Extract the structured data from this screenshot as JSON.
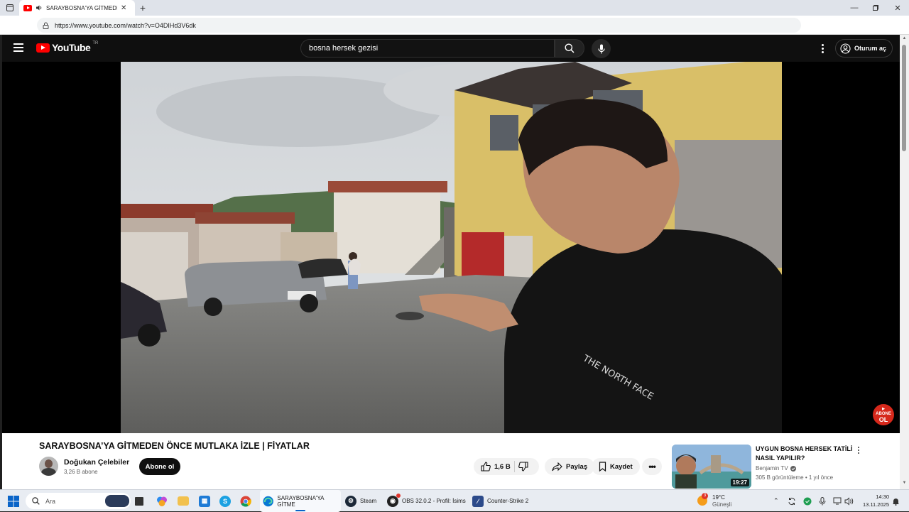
{
  "browser": {
    "tab_title": "SARAYBOSNA'YA GİTMEDEN",
    "url": "https://www.youtube.com/watch?v=O4DIHd3V6dk"
  },
  "youtube": {
    "logo_text": "YouTube",
    "region": "TR",
    "search_query": "bosna hersek gezisi",
    "signin_label": "Oturum aç",
    "badge_line1": "ABONE",
    "badge_line2": "OL"
  },
  "video": {
    "title": "SARAYBOSNA’YA GİTMEDEN ÖNCE MUTLAKA İZLE | FİYATLAR",
    "channel_name": "Doğukan Çelebiler",
    "subscribers": "3,26 B abone",
    "subscribe_label": "Abone ol",
    "likes": "1,6 B",
    "share_label": "Paylaş",
    "save_label": "Kaydet"
  },
  "recommendation": {
    "title": "UYGUN BOSNA HERSEK TATİLİ NASIL YAPILIR?",
    "channel": "Benjamin TV",
    "meta": "305 B görüntüleme • 1 yıl önce",
    "duration": "19:27"
  },
  "taskbar": {
    "search_placeholder": "Ara",
    "items": [
      {
        "label": "SARAYBOSNA'YA GİTME"
      },
      {
        "label": "Steam"
      },
      {
        "label": "OBS 32.0.2 - Profil: İsims"
      },
      {
        "label": "Counter-Strike 2"
      }
    ],
    "weather_temp": "19°C",
    "weather_desc": "Güneşli",
    "weather_badge": "3",
    "time": "14:30",
    "date": "13.11.2025"
  },
  "colors": {
    "youtube_red": "#ff0000",
    "page_dark": "#0f0f0f",
    "edge_accent": "#0a64c8"
  }
}
